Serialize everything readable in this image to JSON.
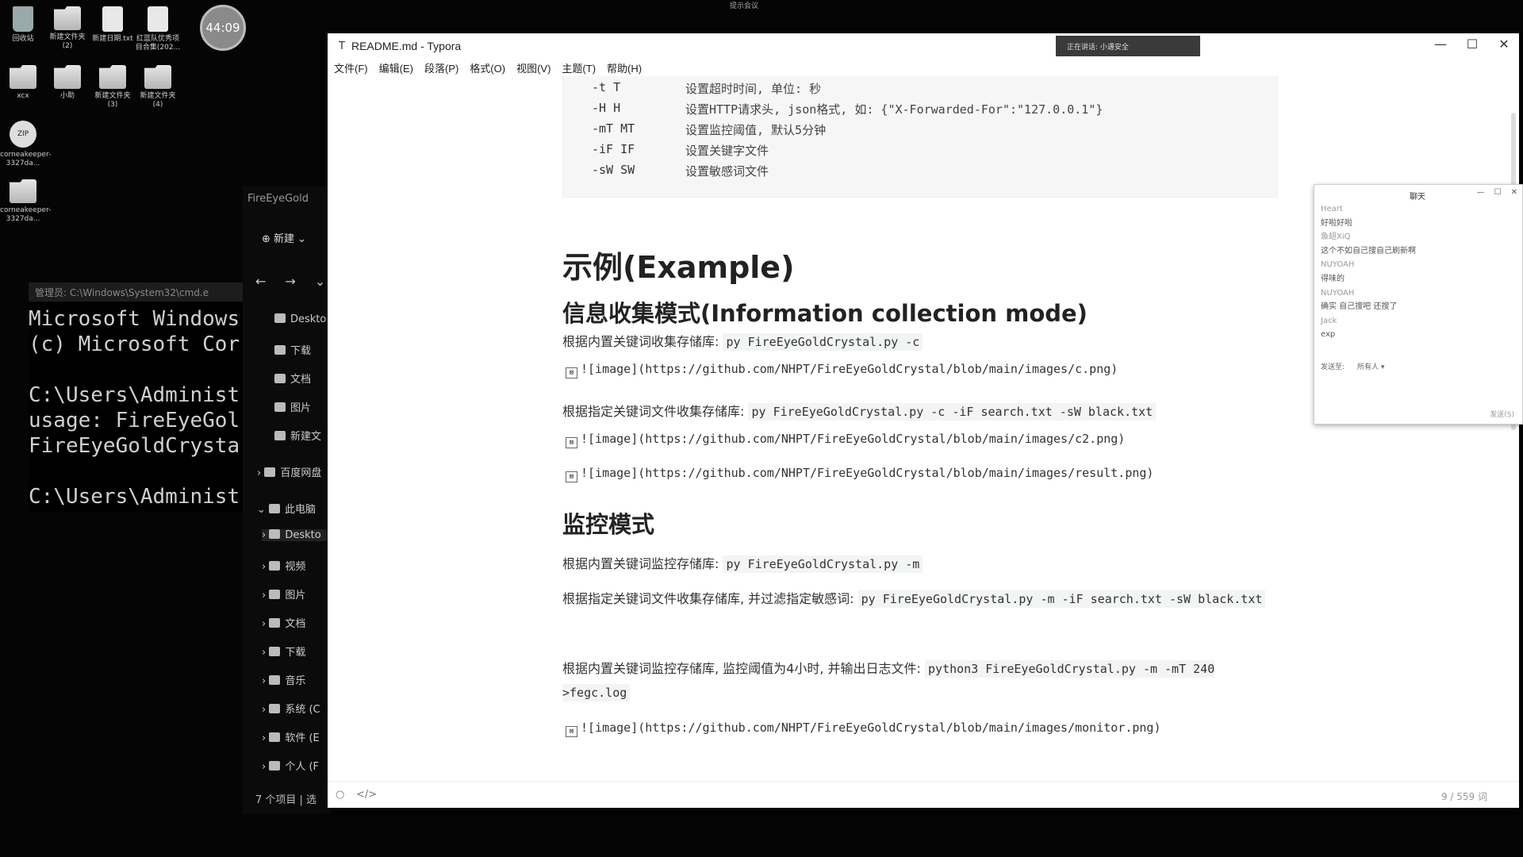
{
  "desktop": {
    "icons": [
      {
        "label": "回收站"
      },
      {
        "label": "新建文件夹 (2)"
      },
      {
        "label": "新建日期.txt"
      },
      {
        "label": "红蓝队优秀项目合集(202..."
      },
      {
        "label": "xcx"
      },
      {
        "label": "小助"
      },
      {
        "label": "新建文件夹 (3)"
      },
      {
        "label": "新建文件夹 (4)"
      },
      {
        "label": "corneakeeper-3327da..."
      },
      {
        "label": "corneakeeper-3327da..."
      }
    ],
    "timer": "44:09",
    "top_notice": "提示会议"
  },
  "cmd": {
    "title": "管理员: C:\\Windows\\System32\\cmd.e",
    "lines": "Microsoft Windows\n(c) Microsoft Cor\n\nC:\\Users\\Administ\nusage: FireEyeGol\nFireEyeGoldCrysta\n\nC:\\Users\\Administ"
  },
  "explorer": {
    "path": "FireEyeGold",
    "new_label": "新建",
    "nav_back": "←",
    "nav_forward": "→",
    "nav_down": "⌄",
    "items": [
      {
        "label": "Deskto"
      },
      {
        "label": "下载"
      },
      {
        "label": "文档"
      },
      {
        "label": "图片"
      },
      {
        "label": "新建文"
      },
      {
        "label": "百度网盘"
      },
      {
        "label": "此电脑"
      },
      {
        "label": "Deskto"
      },
      {
        "label": "视频"
      },
      {
        "label": "图片"
      },
      {
        "label": "文档"
      },
      {
        "label": "下载"
      },
      {
        "label": "音乐"
      },
      {
        "label": "系统 (C"
      },
      {
        "label": "软件 (E"
      },
      {
        "label": "个人 (F"
      }
    ],
    "status": "7 个项目  |  选"
  },
  "typora": {
    "icon": "T",
    "title": "README.md - Typora",
    "meeting_banner": "正在讲话: 小遇安全",
    "controls": {
      "minimize": "—",
      "maximize": "☐",
      "close": "✕"
    },
    "menu": [
      "文件(F)",
      "编辑(E)",
      "段落(P)",
      "格式(O)",
      "视图(V)",
      "主题(T)",
      "帮助(H)"
    ],
    "code_rows": [
      {
        "opt": "-t T",
        "desc": "设置超时时间, 单位: 秒"
      },
      {
        "opt": "-H H",
        "desc": "设置HTTP请求头, json格式, 如: {\"X-Forwarded-For\":\"127.0.0.1\"}"
      },
      {
        "opt": "-mT MT",
        "desc": "设置监控阈值, 默认5分钟"
      },
      {
        "opt": "-iF IF",
        "desc": "设置关键字文件"
      },
      {
        "opt": "-sW SW",
        "desc": "设置敏感词文件"
      }
    ],
    "h1": "示例(Example)",
    "h2_info": "信息收集模式(Information collection mode)",
    "p1_text": "根据内置关键词收集存储库: ",
    "p1_code": "py FireEyeGoldCrystal.py -c",
    "img1": "![image](https://github.com/NHPT/FireEyeGoldCrystal/blob/main/images/c.png)",
    "p2_text": "根据指定关键词文件收集存储库: ",
    "p2_code": "py FireEyeGoldCrystal.py -c -iF search.txt -sW black.txt",
    "img2": "![image](https://github.com/NHPT/FireEyeGoldCrystal/blob/main/images/c2.png)",
    "img3": "![image](https://github.com/NHPT/FireEyeGoldCrystal/blob/main/images/result.png)",
    "h2_monitor": "监控模式",
    "p3_text": "根据内置关键词监控存储库: ",
    "p3_code": "py FireEyeGoldCrystal.py -m",
    "p4_text": "根据指定关键词文件收集存储库, 并过滤指定敏感词: ",
    "p4_code": "py FireEyeGoldCrystal.py -m -iF search.txt -sW black.txt",
    "p5_text": "根据内置关键词监控存储库, 监控阈值为4小时, 并输出日志文件: ",
    "p5_code": "python3 FireEyeGoldCrystal.py -m -mT 240 >fegc.log",
    "img4": "![image](https://github.com/NHPT/FireEyeGoldCrystal/blob/main/images/monitor.png)",
    "word_count": "9 / 559 词"
  },
  "chat": {
    "title": "聊天",
    "messages": [
      {
        "text": "Heart",
        "is_name": true
      },
      {
        "text": "好啦好啦",
        "is_name": false
      },
      {
        "text": "鱼翅XiQ",
        "is_name": true
      },
      {
        "text": "这个不如自己搜自己刷新啊",
        "is_name": false
      },
      {
        "text": "NUYOAH",
        "is_name": true
      },
      {
        "text": "得味的",
        "is_name": false
      },
      {
        "text": "NUYOAH",
        "is_name": true
      },
      {
        "text": "确实 自己搜吧 还搜了",
        "is_name": false
      },
      {
        "text": "Jack",
        "is_name": true
      },
      {
        "text": "exp",
        "is_name": false
      }
    ],
    "send_to_label": "发送至:",
    "send_to_value": "所有人 ▾",
    "send_button": "发送(S)"
  }
}
